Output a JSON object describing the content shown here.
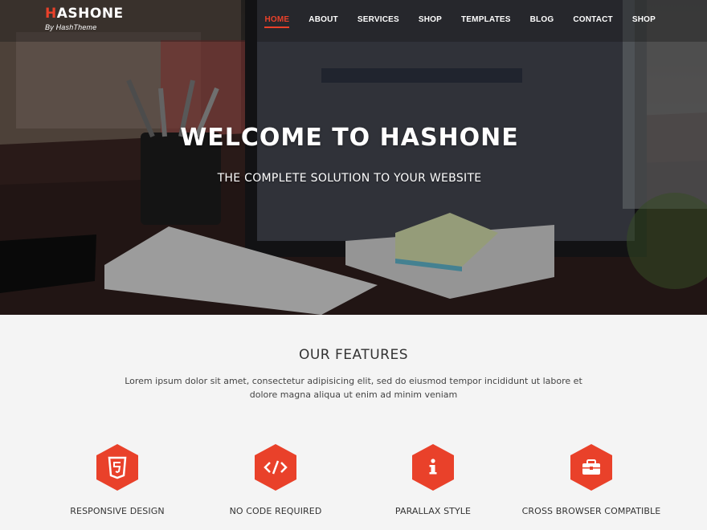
{
  "header": {
    "logo_first_letter": "H",
    "logo_rest": "ASHONE",
    "logo_tagline": "By HashTheme",
    "nav": [
      "HOME",
      "ABOUT",
      "SERVICES",
      "SHOP",
      "TEMPLATES",
      "BLOG",
      "CONTACT",
      "SHOP"
    ],
    "active_nav": "HOME"
  },
  "hero": {
    "title": "WELCOME TO HASHONE",
    "subtitle": "THE COMPLETE SOLUTION TO YOUR WEBSITE"
  },
  "features": {
    "title": "OUR FEATURES",
    "description": "Lorem ipsum dolor sit amet, consectetur adipisicing elit, sed do eiusmod tempor incididunt ut labore et dolore magna aliqua ut enim ad minim veniam",
    "items": [
      {
        "label": "RESPONSIVE DESIGN",
        "icon": "html5-icon"
      },
      {
        "label": "NO CODE REQUIRED",
        "icon": "code-icon"
      },
      {
        "label": "PARALLAX STYLE",
        "icon": "info-icon"
      },
      {
        "label": "CROSS BROWSER COMPATIBLE",
        "icon": "briefcase-icon"
      }
    ]
  },
  "colors": {
    "accent": "#e9412a",
    "text_dark": "#333333",
    "section_bg": "#f4f4f4"
  }
}
